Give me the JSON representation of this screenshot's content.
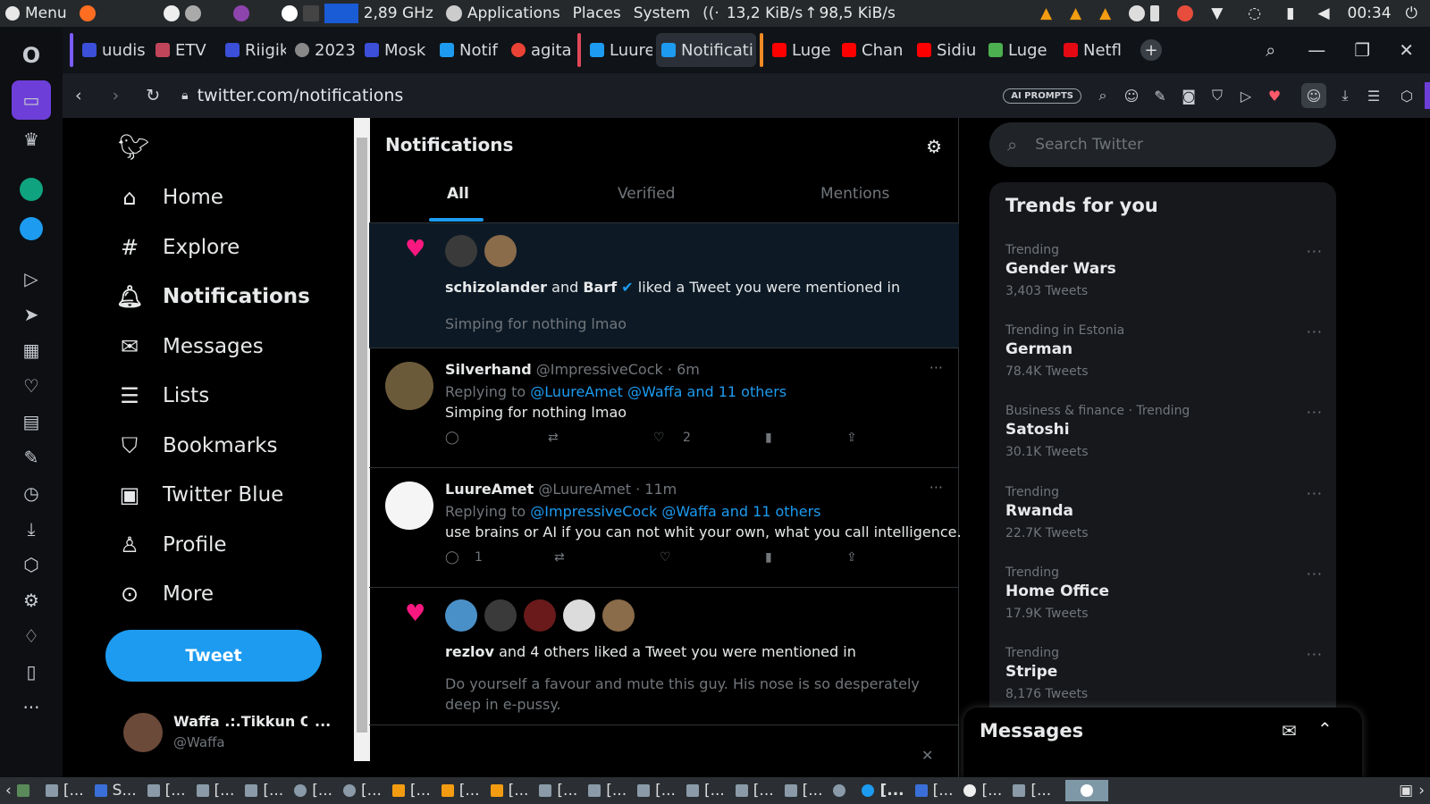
{
  "system_bar": {
    "menu": "Menu",
    "cpu": "2,89 GHz",
    "applications": "Applications",
    "places": "Places",
    "system": "System",
    "net_down": "13,2 KiB/s",
    "net_up": "98,5 KiB/s",
    "clock": "00:34"
  },
  "tabs": [
    {
      "label": "uudis",
      "color": "#3b4fd8"
    },
    {
      "label": "ETV",
      "color": "#c0455a"
    },
    {
      "label": "Riigik",
      "color": "#3b4fd8"
    },
    {
      "label": "2023",
      "color": "#888"
    },
    {
      "label": "Mosk",
      "color": "#3b4fd8"
    },
    {
      "label": "Notif",
      "color": "#1d9bf0"
    },
    {
      "label": "agita",
      "color": "#ea4335"
    },
    {
      "label": "Luure",
      "color": "#1d9bf0"
    },
    {
      "label": "Notificati",
      "color": "#1d9bf0"
    },
    {
      "label": "Luge",
      "color": "#ff0000"
    },
    {
      "label": "Chan",
      "color": "#ff0000"
    },
    {
      "label": "Sidiu",
      "color": "#ff0000"
    },
    {
      "label": "Luge",
      "color": "#4caf50"
    },
    {
      "label": "Netfl",
      "color": "#e50914"
    }
  ],
  "address": {
    "url": "twitter.com/notifications",
    "ai_prompts": "AI PROMPTS"
  },
  "nav": [
    {
      "label": "Home",
      "icon": "home-icon"
    },
    {
      "label": "Explore",
      "icon": "hashtag-icon"
    },
    {
      "label": "Notifications",
      "icon": "bell-icon"
    },
    {
      "label": "Messages",
      "icon": "envelope-icon"
    },
    {
      "label": "Lists",
      "icon": "list-icon"
    },
    {
      "label": "Bookmarks",
      "icon": "bookmark-icon"
    },
    {
      "label": "Twitter Blue",
      "icon": "twitter-blue-icon"
    },
    {
      "label": "Profile",
      "icon": "person-icon"
    },
    {
      "label": "More",
      "icon": "more-circle-icon"
    }
  ],
  "tweet_button": "Tweet",
  "account": {
    "name": "Waffa .:.Tikkun O...",
    "handle": "@Waffa"
  },
  "main": {
    "title": "Notifications",
    "tabs": [
      "All",
      "Verified",
      "Mentions"
    ]
  },
  "notifications": [
    {
      "type": "like",
      "user1": "schizolander",
      "and": "and",
      "user2": "Barf",
      "text": "liked a Tweet you were mentioned in",
      "quote": "Simping for nothing lmao"
    },
    {
      "type": "reply",
      "name": "Silverhand",
      "handle": "@ImpressiveCock",
      "time": "6m",
      "replying_label": "Replying to",
      "replying_to": "@LuureAmet @Waffa and 11 others",
      "text": "Simping for nothing lmao",
      "replies": "",
      "retweets": "",
      "likes": "2"
    },
    {
      "type": "reply",
      "name": "LuureAmet",
      "handle": "@LuureAmet",
      "time": "11m",
      "replying_label": "Replying to",
      "replying_to": "@ImpressiveCock @Waffa and 11 others",
      "text": "use brains or AI if you can not whit your own, what you call intelligence.",
      "replies": "1",
      "retweets": "",
      "likes": ""
    },
    {
      "type": "like",
      "user1": "rezlov",
      "text": "and 4 others liked a Tweet you were mentioned in",
      "quote": "Do yourself a favour and mute this guy. His nose is so desperately deep in e-pussy."
    }
  ],
  "search": {
    "placeholder": "Search Twitter"
  },
  "trends": {
    "title": "Trends for you",
    "items": [
      {
        "context": "Trending",
        "name": "Gender Wars",
        "count": "3,403 Tweets"
      },
      {
        "context": "Trending in Estonia",
        "name": "German",
        "count": "78.4K Tweets"
      },
      {
        "context": "Business & finance · Trending",
        "name": "Satoshi",
        "count": "30.1K Tweets"
      },
      {
        "context": "Trending",
        "name": "Rwanda",
        "count": "22.7K Tweets"
      },
      {
        "context": "Trending",
        "name": "Home Office",
        "count": "17.9K Tweets"
      },
      {
        "context": "Trending",
        "name": "Stripe",
        "count": "8,176 Tweets"
      }
    ]
  },
  "messages_drawer": {
    "title": "Messages"
  },
  "taskbar": [
    "[...",
    "S...",
    "[...",
    "[...",
    "[...",
    "[...",
    "[...",
    "[...",
    "[...",
    "[...",
    "[...",
    "[...",
    "[...",
    "[...",
    "[...",
    "[...",
    "[...",
    "[...",
    "[...",
    "[..."
  ]
}
